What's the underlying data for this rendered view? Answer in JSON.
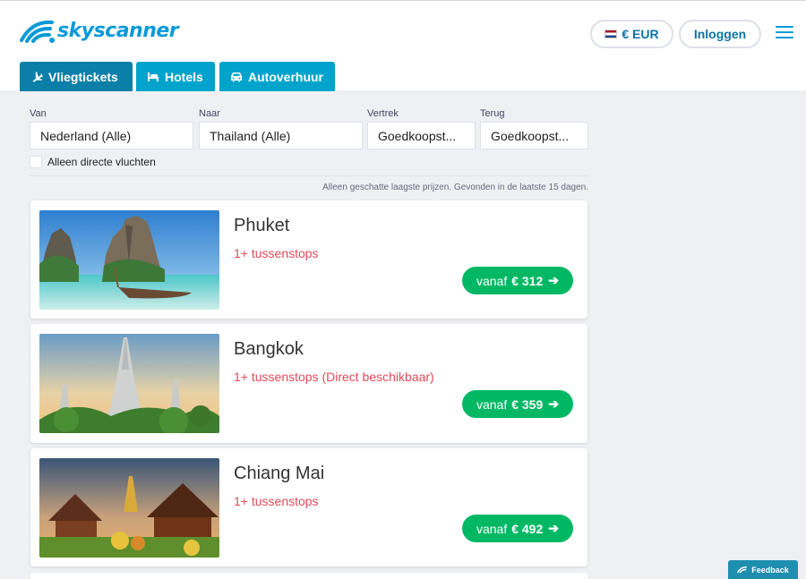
{
  "brand": {
    "name": "skyscanner",
    "color": "#0a9ad8"
  },
  "header": {
    "currency_label": "€ EUR",
    "login_label": "Inloggen",
    "menu_icon": "hamburger-menu-icon"
  },
  "tabs": [
    {
      "label": "Vliegtickets",
      "icon": "plane-icon",
      "active": true
    },
    {
      "label": "Hotels",
      "icon": "bed-icon",
      "active": false
    },
    {
      "label": "Autoverhuur",
      "icon": "car-icon",
      "active": false
    }
  ],
  "search": {
    "from_label": "Van",
    "from_value": "Nederland (Alle)",
    "to_label": "Naar",
    "to_value": "Thailand (Alle)",
    "depart_label": "Vertrek",
    "depart_value": "Goedkoopst...",
    "return_label": "Terug",
    "return_value": "Goedkoopst...",
    "direct_only_label": "Alleen directe vluchten",
    "direct_only_checked": false
  },
  "disclaimer": "Alleen geschatte laagste prijzen. Gevonden in de laatste 15 dagen.",
  "results": [
    {
      "city": "Phuket",
      "stops": "1+ tussenstops",
      "price_prefix": "vanaf",
      "price": "€ 312"
    },
    {
      "city": "Bangkok",
      "stops": "1+ tussenstops (Direct beschikbaar)",
      "price_prefix": "vanaf",
      "price": "€ 359"
    },
    {
      "city": "Chiang Mai",
      "stops": "1+ tussenstops",
      "price_prefix": "vanaf",
      "price": "€ 492"
    }
  ],
  "feedback_label": "Feedback",
  "colors": {
    "accent": "#0a9ad8",
    "tab_active": "#0b7fa7",
    "tab_inactive": "#00a3cc",
    "price_button": "#00b864",
    "stops_text": "#e04b5a"
  }
}
